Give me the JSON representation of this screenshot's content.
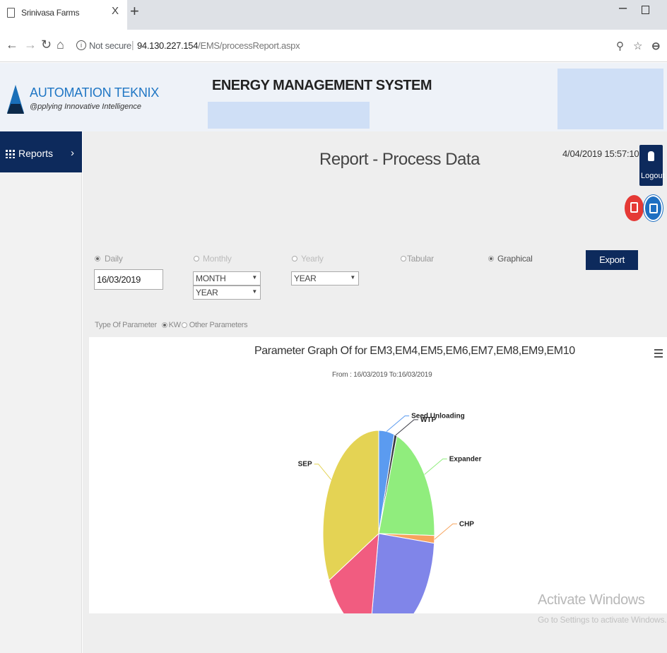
{
  "browser": {
    "tab_title": "Srinivasa Farms",
    "tab_close": "X",
    "new_tab": "+",
    "security_label": "Not secure",
    "url_host": "94.130.227.154",
    "url_path": "/EMS/processReport.aspx"
  },
  "header": {
    "brand": "AUTOMATION TEKNIX",
    "tagline": "@pplying Innovative Intelligence",
    "system_title": "ENERGY MANAGEMENT SYSTEM"
  },
  "sidebar": {
    "items": [
      {
        "label": "Reports",
        "chevron": "›"
      }
    ]
  },
  "main": {
    "title": "Report - Process Data",
    "timestamp": "4/04/2019 15:57:10",
    "logout_label": "Logout",
    "report_types": [
      {
        "label": "Daily",
        "selected": true
      },
      {
        "label": "Monthly",
        "selected": false
      },
      {
        "label": "Yearly",
        "selected": false
      }
    ],
    "view_modes": [
      {
        "label": "Tabular",
        "selected": false
      },
      {
        "label": "Graphical",
        "selected": true
      }
    ],
    "date_value": "16/03/2019",
    "month_select": "MONTH",
    "year_select_1": "YEAR",
    "year_select_2": "YEAR",
    "export_label": "Export",
    "param_label": "Type Of Parameter",
    "param_kw": "KW",
    "param_other": "Other Parameters"
  },
  "chart_data": {
    "type": "pie",
    "title": "Parameter Graph Of for EM3,EM4,EM5,EM6,EM7,EM8,EM9,EM10",
    "subtitle": "From : 16/03/2019 To:16/03/2019",
    "slices": [
      {
        "name": "Seed Unloading",
        "value": 4.5,
        "color": "#5b9bf0"
      },
      {
        "name": "WTP",
        "value": 0.8,
        "color": "#3a3a44"
      },
      {
        "name": "Expander",
        "value": 20,
        "color": "#90ed7d"
      },
      {
        "name": "CHP",
        "value": 1.2,
        "color": "#f7a35c"
      },
      {
        "name": "",
        "value": 26,
        "color": "#8085e9"
      },
      {
        "name": "",
        "value": 15,
        "color": "#f15c80"
      },
      {
        "name": "SEP",
        "value": 32.5,
        "color": "#e4d354"
      }
    ]
  },
  "watermark": {
    "line1": "Activate Windows",
    "line2": "Go to Settings to activate Windows."
  }
}
